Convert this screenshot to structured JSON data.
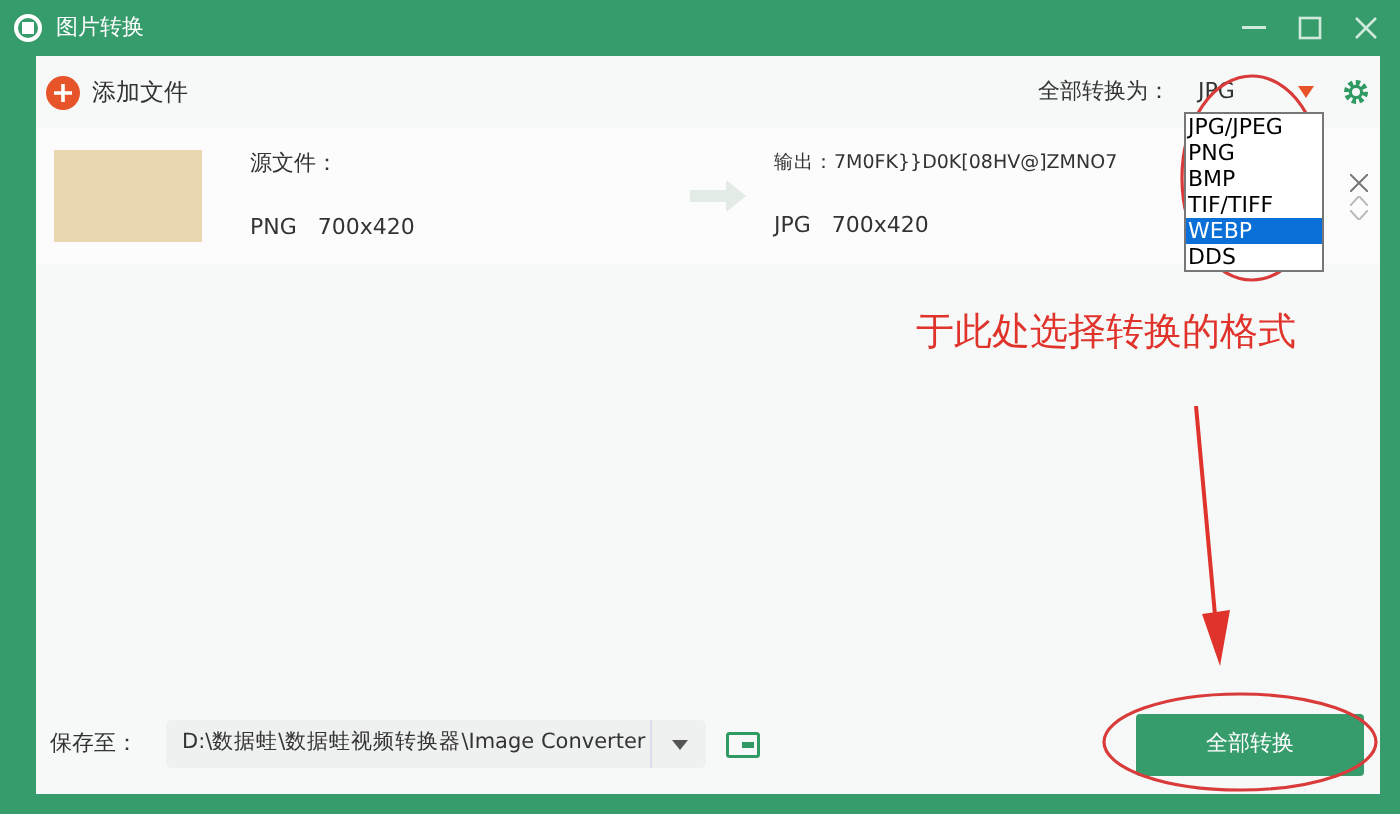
{
  "window": {
    "title": "图片转换"
  },
  "toolbar": {
    "add_button": "添加文件",
    "convert_all_label": "全部转换为：",
    "format_select": {
      "value": "JPG",
      "expanded": true,
      "options": [
        {
          "label": "JPG/JPEG",
          "selected": false
        },
        {
          "label": "PNG",
          "selected": false
        },
        {
          "label": "BMP",
          "selected": false
        },
        {
          "label": "TIF/TIFF",
          "selected": false
        },
        {
          "label": "WEBP",
          "selected": true
        },
        {
          "label": "DDS",
          "selected": false
        }
      ]
    }
  },
  "files": [
    {
      "source_label": "源文件：",
      "source_info": "PNG   700x420",
      "output_label": "输出：7M0FK}}D0K[08HV@]ZMNO7",
      "output_info": "JPG   700x420"
    }
  ],
  "annotation": {
    "text": "于此处选择转换的格式"
  },
  "bottom_bar": {
    "save_label": "保存至：",
    "path": "D:\\数据蛙\\数据蛙视频转换器\\Image Converter",
    "convert_button": "全部转换"
  }
}
